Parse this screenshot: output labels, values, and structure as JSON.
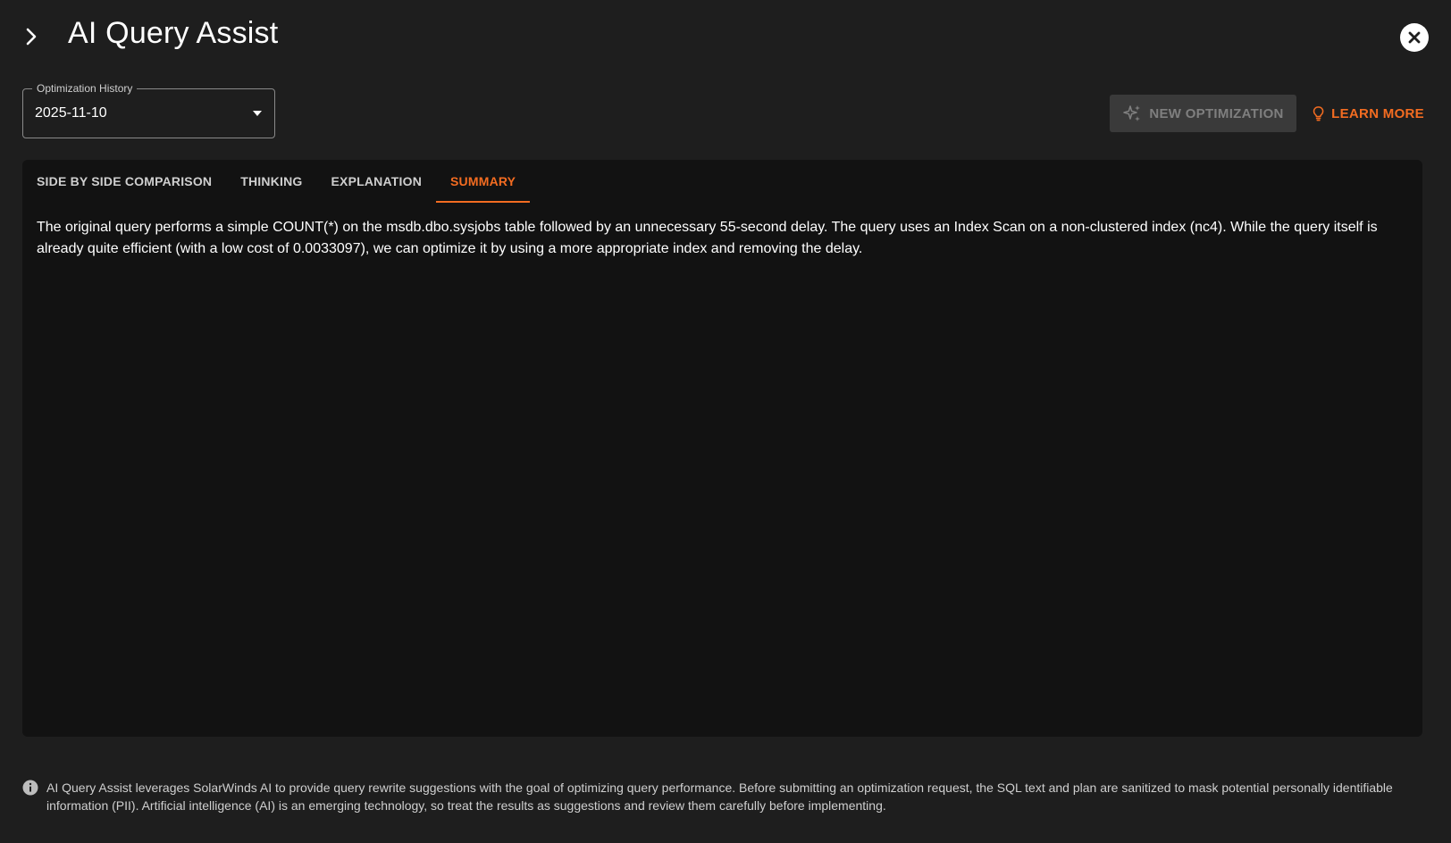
{
  "header": {
    "title": "AI Query Assist"
  },
  "toolbar": {
    "history": {
      "label": "Optimization History",
      "value": "2025-11-10"
    },
    "new_optimization_label": "NEW OPTIMIZATION",
    "learn_more_label": "LEARN MORE"
  },
  "tabs": [
    {
      "label": "SIDE BY SIDE COMPARISON",
      "active": false
    },
    {
      "label": "THINKING",
      "active": false
    },
    {
      "label": "EXPLANATION",
      "active": false
    },
    {
      "label": "SUMMARY",
      "active": true
    }
  ],
  "summary": {
    "text": "The original query performs a simple COUNT(*) on the msdb.dbo.sysjobs table followed by an unnecessary 55-second delay. The query uses an Index Scan on a non-clustered index (nc4). While the query itself is already quite efficient (with a low cost of 0.0033097), we can optimize it by using a more appropriate index and removing the delay."
  },
  "footer": {
    "disclaimer": "AI Query Assist leverages SolarWinds AI to provide query rewrite suggestions with the goal of optimizing query performance. Before submitting an optimization request, the SQL text and plan are sanitized to mask potential personally identifiable information (PII). Artificial intelligence (AI) is an emerging technology, so treat the results as suggestions and review them carefully before implementing."
  },
  "colors": {
    "accent": "#f36c21",
    "background": "#1e1e1e",
    "panel": "#121212",
    "disabled_button": "#3a3a3a"
  },
  "icons": {
    "collapse": "chevron-right-icon",
    "close": "close-circle-icon",
    "dropdown": "caret-down-icon",
    "new_optimization": "sparkles-icon",
    "learn_more": "lightbulb-icon",
    "info": "info-circle-icon"
  }
}
